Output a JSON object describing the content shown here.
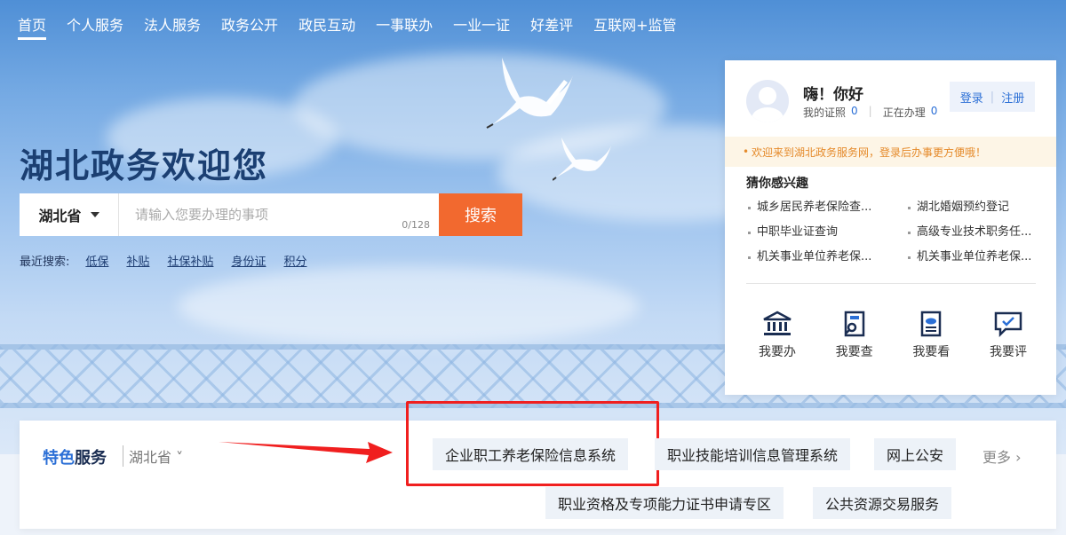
{
  "nav": {
    "items": [
      "首页",
      "个人服务",
      "法人服务",
      "政务公开",
      "政民互动",
      "一事联办",
      "一业一证",
      "好差评",
      "互联网+监管"
    ]
  },
  "hero": {
    "welcome": "湖北政务欢迎您"
  },
  "search": {
    "region": "湖北省",
    "placeholder": "请输入您要办理的事项",
    "counter": "0/128",
    "button": "搜索"
  },
  "recent": {
    "label": "最近搜索:",
    "links": [
      "低保",
      "补贴",
      "社保补贴",
      "身份证",
      "积分"
    ]
  },
  "user_card": {
    "greeting": "嗨！你好",
    "my_items_label": "我的证照",
    "my_items_count": "0",
    "in_progress_label": "正在办理",
    "in_progress_count": "0",
    "login": "登录",
    "register": "注册",
    "notice": "欢迎来到湖北政务服务网，登录后办事更方便哦！",
    "interest_title": "猜你感兴趣",
    "interests": [
      "城乡居民养老保险查...",
      "湖北婚姻预约登记",
      "中职毕业证查询",
      "高级专业技术职务任...",
      "机关事业单位养老保...",
      "机关事业单位养老保..."
    ],
    "actions": [
      {
        "label": "我要办",
        "icon": "bank-icon"
      },
      {
        "label": "我要查",
        "icon": "search-doc-icon"
      },
      {
        "label": "我要看",
        "icon": "document-icon"
      },
      {
        "label": "我要评",
        "icon": "comment-icon"
      }
    ]
  },
  "features": {
    "title_part1": "特色",
    "title_part2": "服务",
    "region": "湖北省",
    "services": [
      "企业职工养老保险信息系统",
      "职业技能培训信息管理系统",
      "网上公安",
      "职业资格及专项能力证书申请专区",
      "公共资源交易服务"
    ],
    "more": "更多 ›",
    "highlight_color": "#f01f1f",
    "accent_color": "#2b6fd6",
    "search_button_color": "#f2692f"
  }
}
